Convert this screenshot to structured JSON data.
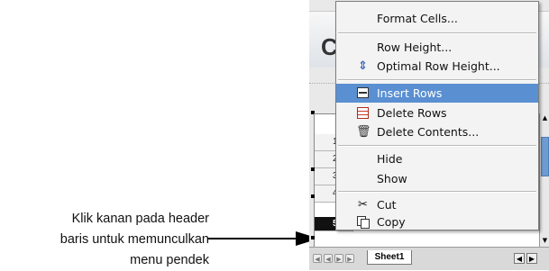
{
  "annotation": {
    "lines": [
      "Klik kanan pada header",
      "baris untuk memunculkan",
      "menu pendek"
    ]
  },
  "document": {
    "title_fragment": "C"
  },
  "sheet": {
    "row_numbers": [
      "1",
      "2",
      "3",
      "4",
      "5"
    ],
    "selected_row": "5",
    "tab_label": "Sheet1"
  },
  "context_menu": {
    "items": [
      {
        "label": "Format Cells...",
        "icon": "none"
      },
      {
        "label": "Row Height...",
        "icon": "none"
      },
      {
        "label": "Optimal Row Height...",
        "icon": "optimal-row-height-icon"
      },
      {
        "label": "Insert Rows",
        "icon": "insert-rows-icon",
        "highlighted": true
      },
      {
        "label": "Delete Rows",
        "icon": "delete-rows-icon"
      },
      {
        "label": "Delete Contents...",
        "icon": "delete-contents-icon"
      },
      {
        "label": "Hide",
        "icon": "none"
      },
      {
        "label": "Show",
        "icon": "none"
      },
      {
        "label": "Cut",
        "icon": "scissors-icon"
      },
      {
        "label": "Copy",
        "icon": "copy-icon"
      }
    ]
  },
  "colors": {
    "highlight": "#5a8fd2",
    "menu_background": "#f3f3f3",
    "scroll_thumb": "#6e9bd1"
  }
}
